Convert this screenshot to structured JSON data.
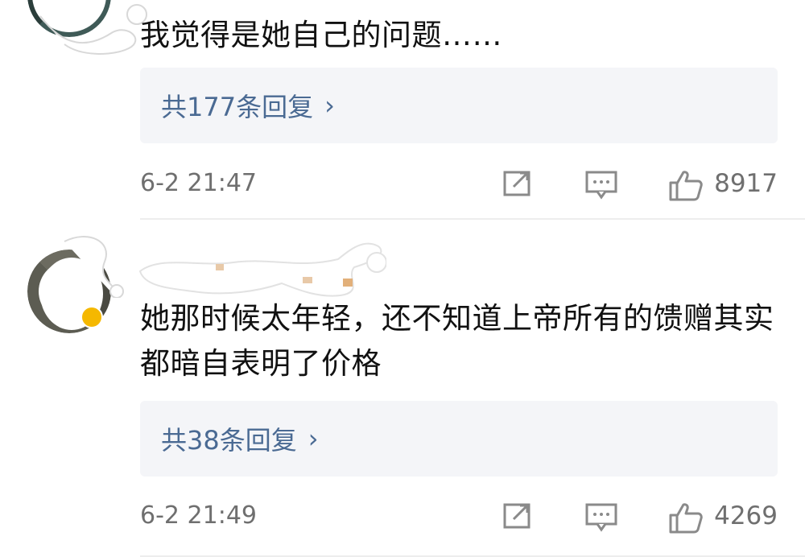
{
  "comments": [
    {
      "text": "我觉得是她自己的问题……",
      "replies_label": "共177条回复",
      "time": "6-2 21:47",
      "likes": "8917"
    },
    {
      "text": "她那时候太年轻，还不知道上帝所有的馈赠其实都暗自表明了价格",
      "replies_label": "共38条回复",
      "time": "6-2 21:49",
      "likes": "4269"
    }
  ],
  "icons": {
    "share": "share-icon",
    "comment": "comment-icon",
    "like": "thumbs-up-icon",
    "chevron": "chevron-right-icon"
  },
  "colors": {
    "link": "#4a6a93",
    "reply_box": "#f4f5f8",
    "meta_text": "#6f6f6f",
    "verified_badge": "#f5b800"
  }
}
